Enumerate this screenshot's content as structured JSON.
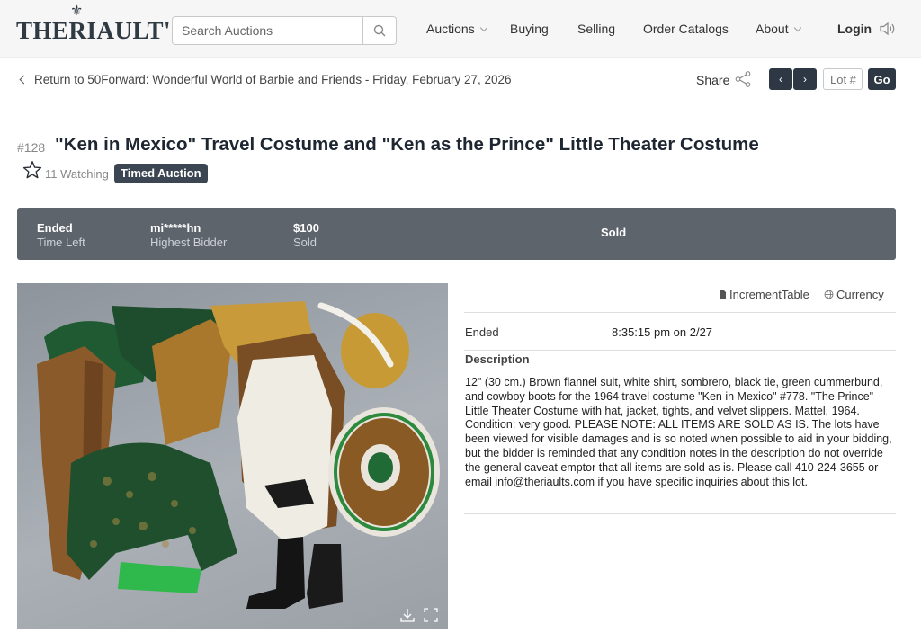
{
  "header": {
    "logo_text": "THERIAULT'S",
    "search": {
      "placeholder": "Search Auctions"
    },
    "nav": [
      {
        "label": "Auctions",
        "has_dropdown": true
      },
      {
        "label": "Buying",
        "has_dropdown": false
      },
      {
        "label": "Selling",
        "has_dropdown": false
      },
      {
        "label": "Order Catalogs",
        "has_dropdown": false
      },
      {
        "label": "About",
        "has_dropdown": true
      }
    ],
    "login_label": "Login"
  },
  "breadcrumb": {
    "back_label": "Return to 50Forward: Wonderful World of Barbie and Friends - Friday, February 27, 2026",
    "share_label": "Share",
    "prev_glyph": "‹",
    "next_glyph": "›",
    "lot_placeholder": "Lot #",
    "go_label": "Go"
  },
  "lot": {
    "number": "#128",
    "title": "\"Ken in Mexico\" Travel Costume and \"Ken as the Prince\" Little Theater Costume",
    "watching": "11 Watching",
    "badge": "Timed Auction"
  },
  "status": {
    "time_value": "Ended",
    "time_label": "Time Left",
    "bidder_value": "mi*****hn",
    "bidder_label": "Highest Bidder",
    "price_value": "$100",
    "price_label": "Sold",
    "result": "Sold"
  },
  "details": {
    "increment_label": "IncrementTable",
    "currency_label": "Currency",
    "ended_label": "Ended",
    "ended_value": "8:35:15 pm on 2/27",
    "description_heading": "Description",
    "description": "12\" (30 cm.) Brown flannel suit, white shirt, sombrero, black tie, green cummerbund, and cowboy boots for the 1964 travel costume \"Ken in Mexico\" #778. \"The Prince\" Little Theater Costume with hat, jacket, tights, and velvet slippers. Mattel, 1964. Condition: very good. PLEASE NOTE: ALL ITEMS ARE SOLD AS IS. The lots have been viewed for visible damages and is so noted when possible to aid in your bidding, but the bidder is reminded that any condition notes in the description do not override the general caveat emptor that all items are sold as is. Please call 410-224-3655 or email info@theriaults.com if you have specific inquiries about this lot."
  },
  "colors": {
    "dark_button": "#2e3844",
    "status_bar": "#5d646c",
    "badge": "#3c4652",
    "title": "#1d2631"
  },
  "icons": [
    "search-icon",
    "chevron-down-icon",
    "speaker-icon",
    "back-arrow-icon",
    "share-icon",
    "star-icon",
    "document-icon",
    "globe-icon",
    "download-icon",
    "expand-icon"
  ]
}
